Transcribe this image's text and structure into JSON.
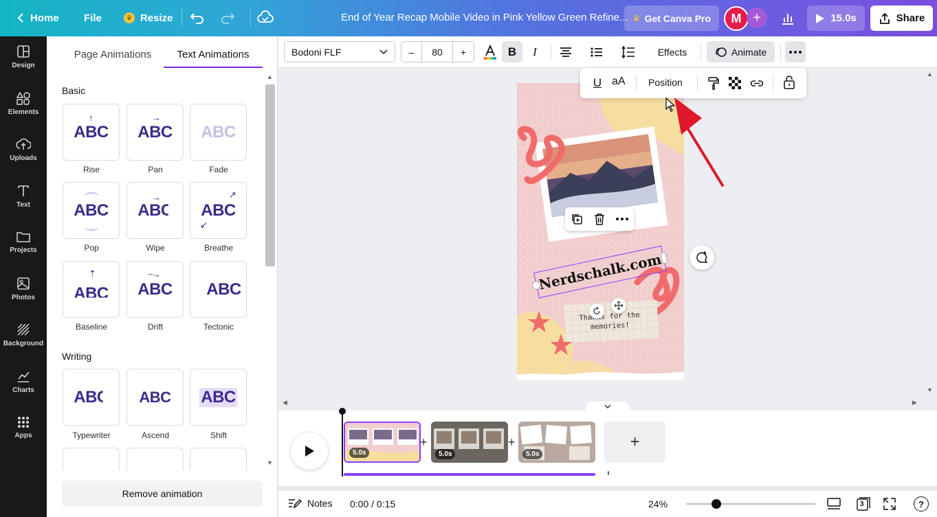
{
  "topbar": {
    "home": "Home",
    "file": "File",
    "resize": "Resize",
    "title": "End of Year Recap Mobile Video in Pink Yellow Green Refine...",
    "get_pro": "Get Canva Pro",
    "avatar_initial": "M",
    "play_duration": "15.0s",
    "share": "Share"
  },
  "rail": [
    {
      "label": "Design",
      "icon": "design-icon"
    },
    {
      "label": "Elements",
      "icon": "elements-icon"
    },
    {
      "label": "Uploads",
      "icon": "upload-icon"
    },
    {
      "label": "Text",
      "icon": "text-icon"
    },
    {
      "label": "Projects",
      "icon": "folder-icon"
    },
    {
      "label": "Photos",
      "icon": "photo-icon"
    },
    {
      "label": "Background",
      "icon": "background-icon"
    },
    {
      "label": "Charts",
      "icon": "chart-icon"
    },
    {
      "label": "Apps",
      "icon": "apps-icon"
    }
  ],
  "panel": {
    "tab_page": "Page Animations",
    "tab_text": "Text Animations",
    "section_basic": "Basic",
    "section_writing": "Writing",
    "basic": [
      "Rise",
      "Pan",
      "Fade",
      "Pop",
      "Wipe",
      "Breathe",
      "Baseline",
      "Drift",
      "Tectonic"
    ],
    "writing": [
      "Typewriter",
      "Ascend",
      "Shift"
    ],
    "sample_text": "ABC",
    "remove": "Remove animation"
  },
  "toolbar": {
    "font": "Bodoni FLF",
    "minus": "–",
    "size": "80",
    "plus": "+",
    "effects": "Effects",
    "animate": "Animate"
  },
  "popover": {
    "case": "aA",
    "position": "Position"
  },
  "canvas": {
    "headline": "Nerdschalk.com",
    "note_line1": "Thanks for the",
    "note_line2": "memories!"
  },
  "timeline": {
    "clips": [
      "5.0s",
      "5.0s",
      "5.0s"
    ],
    "add": "+"
  },
  "footer": {
    "notes": "Notes",
    "time": "0:00 / 0:15",
    "zoom": "24%",
    "zoom_level": 0.24,
    "pages": "3"
  },
  "colors": {
    "accent": "#7d2ae8",
    "avatar": "#e51d4b",
    "canvas_pink": "#f2cfcf",
    "scribble": "#f26b6b",
    "arrow": "#e0182b"
  }
}
